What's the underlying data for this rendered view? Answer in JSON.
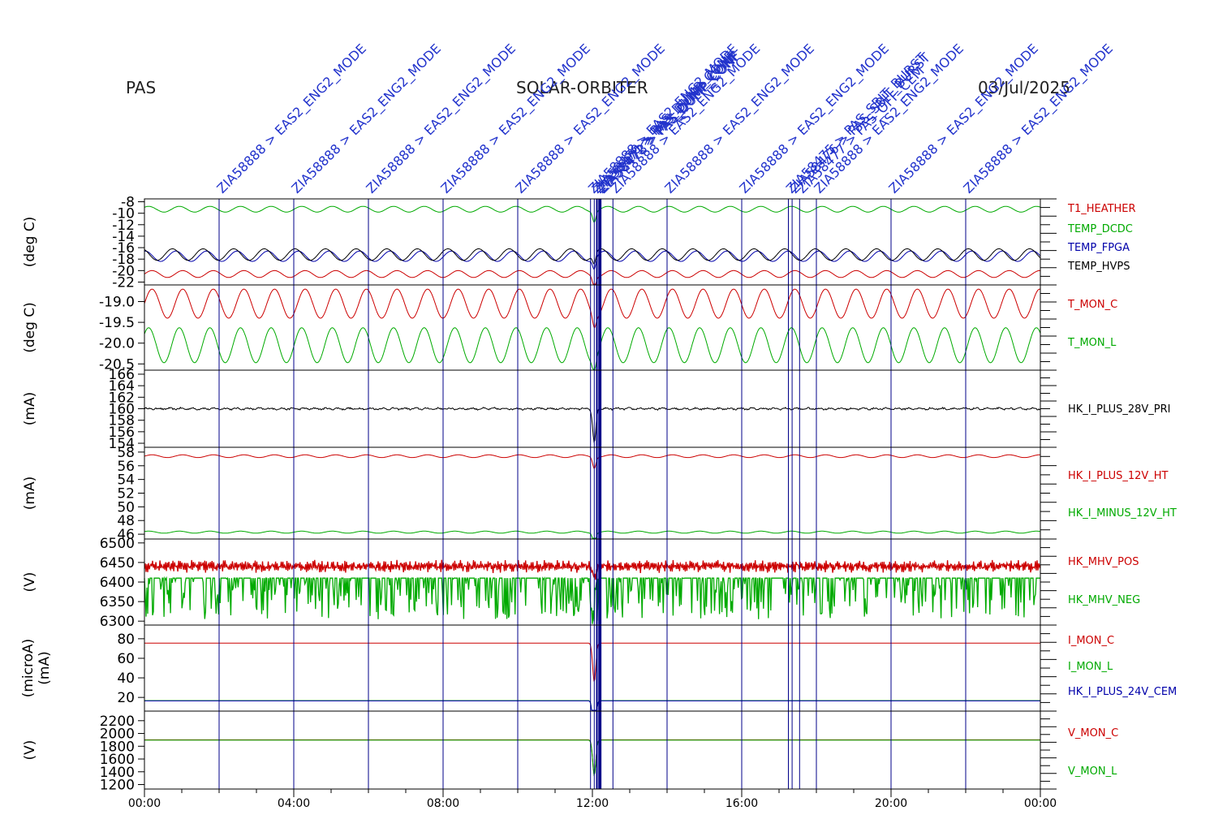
{
  "header": {
    "left": "PAS",
    "center": "SOLAR-ORBITER",
    "right": "03/Jul/2025"
  },
  "colors": {
    "red": "#cc0000",
    "green": "#00aa00",
    "blue": "#0000aa",
    "black": "#000000",
    "event_text": "#2233cc",
    "event_line": "#000088"
  },
  "time_axis": {
    "start": "00:00",
    "end": "24:00",
    "tick_labels": [
      "00:00",
      "04:00",
      "08:00",
      "12:00",
      "16:00",
      "20:00",
      "00:00"
    ]
  },
  "events": [
    {
      "t": 2.0,
      "label": "ZIA58888 > EAS2_ENG2_MODE"
    },
    {
      "t": 4.0,
      "label": "ZIA58888 > EAS2_ENG2_MODE"
    },
    {
      "t": 6.0,
      "label": "ZIA58888 > EAS2_ENG2_MODE"
    },
    {
      "t": 8.0,
      "label": "ZIA58888 > EAS2_ENG2_MODE"
    },
    {
      "t": 10.0,
      "label": "ZIA58888 > EAS2_ENG2_MODE"
    },
    {
      "t": 11.95,
      "label": "ZIA58888 > EAS2_ENG2_MODE"
    },
    {
      "t": 12.05,
      "label": "ZIA58470 > PAS_DUMP_CONF"
    },
    {
      "t": 12.12,
      "label": "ZIA58471 > PAS_DUMP_CONF"
    },
    {
      "t": 12.18,
      "label": "ZIA58472 > PAS_DUMP_CONF"
    },
    {
      "t": 12.22,
      "label": "ZIA58473 > PAS_DUMP_CONF"
    },
    {
      "t": 12.55,
      "label": "ZIA58888 > EAS2_ENG2_MODE"
    },
    {
      "t": 14.0,
      "label": "ZIA58888 > EAS2_ENG2_MODE"
    },
    {
      "t": 16.0,
      "label": "ZIA58888 > EAS2_ENG2_MODE"
    },
    {
      "t": 17.25,
      "label": "ZIA58475 > PAS_SBIT_BURST"
    },
    {
      "t": 17.35,
      "label": "ZIA58476 > PAS_SBIT_BURST"
    },
    {
      "t": 17.55,
      "label": "ZIA58477 > PAS_OFF_CEM"
    },
    {
      "t": 18.0,
      "label": "ZIA58888 > EAS2_ENG2_MODE"
    },
    {
      "t": 20.0,
      "label": "ZIA58888 > EAS2_ENG2_MODE"
    },
    {
      "t": 22.0,
      "label": "ZIA58888 > EAS2_ENG2_MODE"
    }
  ],
  "chart_data": [
    {
      "type": "line",
      "ylabel": "(deg C)",
      "yticks": [
        -8,
        -10,
        -12,
        -14,
        -16,
        -18,
        -20,
        -22
      ],
      "ylim": [
        -22.5,
        -7.5
      ],
      "series": [
        {
          "name": "T1_HEATHER",
          "color": "red",
          "base": -20.6,
          "amp": 0.6,
          "period": 0.82
        },
        {
          "name": "TEMP_DCDC",
          "color": "green",
          "base": -9.3,
          "amp": 0.5,
          "period": 0.82
        },
        {
          "name": "TEMP_FPGA",
          "color": "blue",
          "base": -17.5,
          "amp": 0.9,
          "period": 0.82
        },
        {
          "name": "TEMP_HVPS",
          "color": "black",
          "base": -17.2,
          "amp": 1.0,
          "period": 0.82
        }
      ]
    },
    {
      "type": "line",
      "ylabel": "(deg C)",
      "yticks": [
        "-19.0",
        "-19.5",
        "-20.0",
        "-20.5"
      ],
      "ylim": [
        -20.65,
        -18.6
      ],
      "series": [
        {
          "name": "T_MON_C",
          "color": "red",
          "base": -19.05,
          "amp": 0.35,
          "period": 0.82
        },
        {
          "name": "T_MON_L",
          "color": "green",
          "base": -20.05,
          "amp": 0.42,
          "period": 0.82
        }
      ]
    },
    {
      "type": "line",
      "ylabel": "(mA)",
      "yticks": [
        166,
        164,
        162,
        160,
        158,
        156,
        154
      ],
      "ylim": [
        153.3,
        166.7
      ],
      "series": [
        {
          "name": "HK_I_PLUS_28V_PRI",
          "color": "black",
          "base": 160.0,
          "amp": 0.12,
          "period": 0.3
        }
      ]
    },
    {
      "type": "line",
      "ylabel": "(mA)",
      "yticks": [
        58,
        56,
        54,
        52,
        50,
        48,
        46
      ],
      "ylim": [
        45.3,
        58.7
      ],
      "series": [
        {
          "name": "HK_I_PLUS_12V_HT",
          "color": "red",
          "base": 57.4,
          "amp": 0.2,
          "period": 0.82
        },
        {
          "name": "HK_I_MINUS_12V_HT",
          "color": "green",
          "base": 46.3,
          "amp": 0.15,
          "period": 0.82
        }
      ]
    },
    {
      "type": "line",
      "ylabel": "(V)",
      "yticks": [
        6500,
        6450,
        6400,
        6350,
        6300
      ],
      "ylim": [
        6290,
        6510
      ],
      "series": [
        {
          "name": "HK_MHV_POS",
          "color": "red",
          "base": 6440,
          "amp": 10,
          "period": 0.05
        },
        {
          "name": "HK_MHV_NEG",
          "color": "green",
          "base": 6410,
          "amp": 0,
          "period": 0.05
        }
      ]
    },
    {
      "type": "line",
      "ylabel": "(microA)",
      "ylabel2": "(mA)",
      "yticks": [
        80,
        60,
        40,
        20
      ],
      "ylim": [
        6,
        94
      ],
      "series": [
        {
          "name": "I_MON_C",
          "color": "red",
          "base": 75.5,
          "amp": 0,
          "period": 1
        },
        {
          "name": "I_MON_L",
          "color": "green",
          "base": 16.8,
          "amp": 0,
          "period": 1
        },
        {
          "name": "HK_I_PLUS_24V_CEM",
          "color": "blue",
          "base": 16.5,
          "amp": 0,
          "period": 1
        }
      ]
    },
    {
      "type": "line",
      "ylabel": "(V)",
      "yticks": [
        2200,
        2000,
        1800,
        1600,
        1400,
        1200
      ],
      "ylim": [
        1130,
        2350
      ],
      "series": [
        {
          "name": "V_MON_C",
          "color": "red",
          "base": 1900,
          "amp": 0,
          "period": 1
        },
        {
          "name": "V_MON_L",
          "color": "green",
          "base": 1895,
          "amp": 0,
          "period": 1
        }
      ]
    }
  ]
}
